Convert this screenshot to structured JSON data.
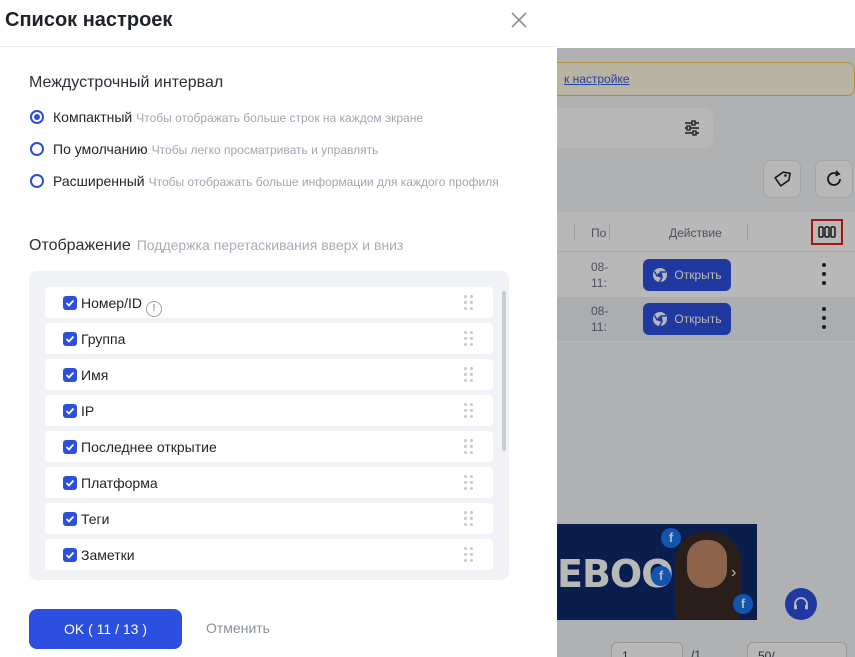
{
  "drawer": {
    "title": "Список настроек",
    "line_spacing": {
      "title": "Междустрочный интервал",
      "options": [
        {
          "label": "Компактный",
          "desc": "Чтобы отображать больше строк на каждом экране",
          "checked": true
        },
        {
          "label": "По умолчанию",
          "desc": "Чтобы легко просматривать и управлять",
          "checked": false
        },
        {
          "label": "Расширенный",
          "desc": "Чтобы отображать больше информации для каждого профиля",
          "checked": false
        }
      ]
    },
    "display": {
      "title": "Отображение",
      "hint": "Поддержка перетаскивания вверх и вниз",
      "items": [
        {
          "label": "Номер/ID",
          "checked": true,
          "info": true
        },
        {
          "label": "Группа",
          "checked": true
        },
        {
          "label": "Имя",
          "checked": true
        },
        {
          "label": "IP",
          "checked": true
        },
        {
          "label": "Последнее открытие",
          "checked": true
        },
        {
          "label": "Платформа",
          "checked": true
        },
        {
          "label": "Теги",
          "checked": true
        },
        {
          "label": "Заметки",
          "checked": true
        }
      ]
    },
    "ok_label": "OK ( 11 / 13 )",
    "cancel_label": "Отменить"
  },
  "background": {
    "notice_link": "к настройке",
    "table": {
      "col_po": "По",
      "col_action": "Действие",
      "rows": [
        {
          "date_line1": "08-",
          "date_line2": "11:",
          "open_label": "Открыть"
        },
        {
          "date_line1": "08-",
          "date_line2": "11:",
          "open_label": "Открыть"
        }
      ]
    },
    "banner_text": "EBOOK",
    "pager": {
      "page": "1",
      "of": "/1",
      "size": "50/"
    }
  },
  "colors": {
    "accent": "#2d4fe0",
    "highlight_border": "#e02020"
  },
  "icons": [
    "close-icon",
    "filter-icon",
    "tag-icon",
    "refresh-icon",
    "columns-icon",
    "chrome-icon",
    "more-vertical-icon",
    "drag-handle-icon",
    "info-icon",
    "support-icon",
    "check-icon"
  ]
}
